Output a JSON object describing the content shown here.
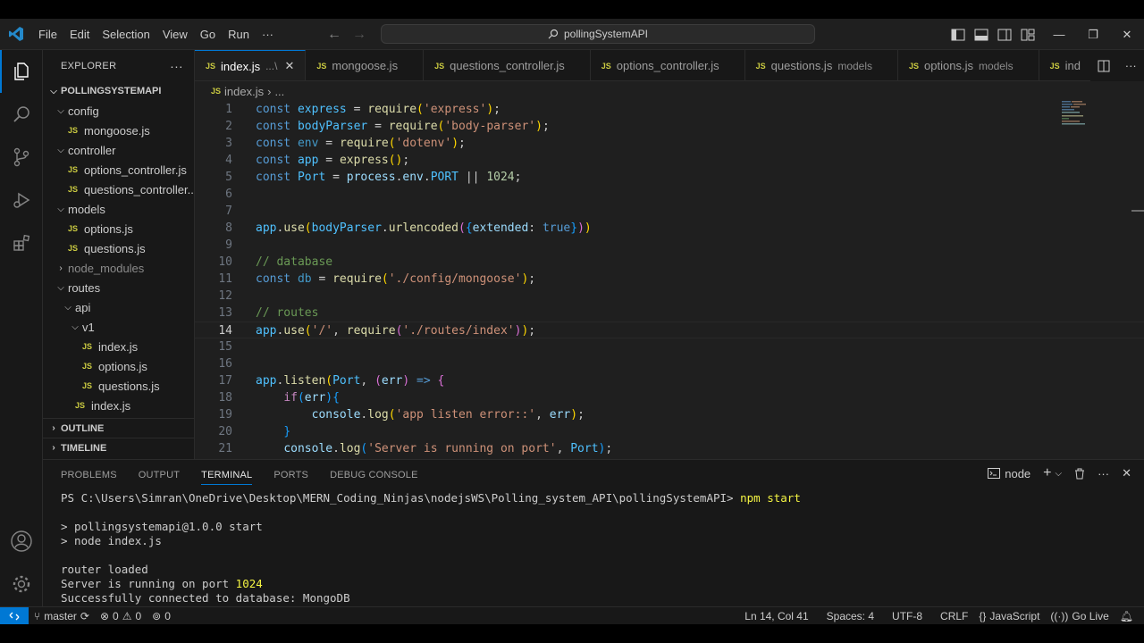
{
  "titlebar": {
    "menu": [
      "File",
      "Edit",
      "Selection",
      "View",
      "Go",
      "Run",
      "···"
    ],
    "search_text": "pollingSystemAPI"
  },
  "sidebar": {
    "title": "EXPLORER",
    "more": "···",
    "project": "POLLINGSYSTEMAPI",
    "tree": [
      {
        "label": "config",
        "type": "folder",
        "open": true,
        "depth": 1
      },
      {
        "label": "mongoose.js",
        "type": "file",
        "depth": 2
      },
      {
        "label": "controller",
        "type": "folder",
        "open": true,
        "depth": 1
      },
      {
        "label": "options_controller.js",
        "type": "file",
        "depth": 2
      },
      {
        "label": "questions_controller...",
        "type": "file",
        "depth": 2
      },
      {
        "label": "models",
        "type": "folder",
        "open": true,
        "depth": 1
      },
      {
        "label": "options.js",
        "type": "file",
        "depth": 2
      },
      {
        "label": "questions.js",
        "type": "file",
        "depth": 2
      },
      {
        "label": "node_modules",
        "type": "folder",
        "open": false,
        "depth": 1,
        "dim": true
      },
      {
        "label": "routes",
        "type": "folder",
        "open": true,
        "depth": 1
      },
      {
        "label": "api",
        "type": "folder",
        "open": true,
        "depth": 2
      },
      {
        "label": "v1",
        "type": "folder",
        "open": true,
        "depth": 3
      },
      {
        "label": "index.js",
        "type": "file",
        "depth": 4
      },
      {
        "label": "options.js",
        "type": "file",
        "depth": 4
      },
      {
        "label": "questions.js",
        "type": "file",
        "depth": 4
      },
      {
        "label": "index.js",
        "type": "file",
        "depth": 3
      }
    ],
    "outline": "OUTLINE",
    "timeline": "TIMELINE"
  },
  "tabs": [
    {
      "name": "index.js",
      "desc": "...\\",
      "active": true
    },
    {
      "name": "mongoose.js",
      "desc": ""
    },
    {
      "name": "questions_controller.js",
      "desc": ""
    },
    {
      "name": "options_controller.js",
      "desc": ""
    },
    {
      "name": "questions.js",
      "desc": "models"
    },
    {
      "name": "options.js",
      "desc": "models"
    },
    {
      "name": "ind",
      "desc": ""
    }
  ],
  "breadcrumb": {
    "file": "index.js",
    "rest": "..."
  },
  "code_lines": [
    "1",
    "2",
    "3",
    "4",
    "5",
    "6",
    "7",
    "8",
    "9",
    "10",
    "11",
    "12",
    "13",
    "14",
    "15",
    "16",
    "17",
    "18",
    "19",
    "20",
    "21"
  ],
  "code": {
    "l1": {
      "a": "const",
      "b": "express",
      "c": "require",
      "d": "'express'"
    },
    "l2": {
      "a": "const",
      "b": "bodyParser",
      "c": "require",
      "d": "'body-parser'"
    },
    "l3": {
      "a": "const",
      "b": "env",
      "c": "require",
      "d": "'dotenv'"
    },
    "l4": {
      "a": "const",
      "b": "app",
      "c": "express"
    },
    "l5": {
      "a": "const",
      "b": "Port",
      "c": "process",
      "d": "env",
      "e": "PORT",
      "f": "1024"
    },
    "l8": {
      "a": "app",
      "b": "use",
      "c": "bodyParser",
      "d": "urlencoded",
      "e": "extended",
      "f": "true"
    },
    "l10": "// database",
    "l11": {
      "a": "const",
      "b": "db",
      "c": "require",
      "d": "'./config/mongoose'"
    },
    "l13": "// routes",
    "l14": {
      "a": "app",
      "b": "use",
      "c": "'/'",
      "d": "require",
      "e": "'./routes/index'"
    },
    "l17": {
      "a": "app",
      "b": "listen",
      "c": "Port",
      "d": "err"
    },
    "l18": {
      "a": "if",
      "b": "err"
    },
    "l19": {
      "a": "console",
      "b": "log",
      "c": "'app listen error::'",
      "d": "err"
    },
    "l21": {
      "a": "console",
      "b": "log",
      "c": "'Server is running on port'",
      "d": "Port"
    }
  },
  "panel": {
    "tabs": [
      "PROBLEMS",
      "OUTPUT",
      "TERMINAL",
      "PORTS",
      "DEBUG CONSOLE"
    ],
    "active_tab": "TERMINAL",
    "shell": "node",
    "prompt": "PS C:\\Users\\Simran\\OneDrive\\Desktop\\MERN_Coding_Ninjas\\nodejsWS\\Polling_system_API\\pollingSystemAPI>",
    "command": "npm start",
    "lines": {
      "l1": "> pollingsystemapi@1.0.0 start",
      "l2": "> node index.js",
      "l3": "router loaded",
      "l4a": "Server is running on port ",
      "l4b": "1024",
      "l5": "Successfully connected to database: MongoDB"
    }
  },
  "statusbar": {
    "branch": "master",
    "errors": "0",
    "warnings": "0",
    "ports": "0",
    "position": "Ln 14, Col 41",
    "spaces": "Spaces: 4",
    "encoding": "UTF-8",
    "eol": "CRLF",
    "language": "JavaScript",
    "golive": "Go Live"
  },
  "colors": {
    "accent": "#0078d4",
    "js": "#cbcb41"
  }
}
